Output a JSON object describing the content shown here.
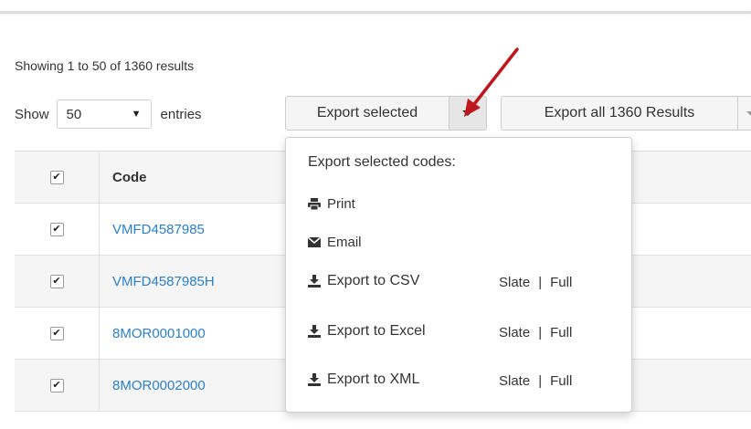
{
  "summary": "Showing 1 to 50 of 1360 results",
  "length_control": {
    "show_label": "Show",
    "selected": "50",
    "entries_label": "entries"
  },
  "toolbar": {
    "export_selected_label": "Export selected",
    "export_all_label": "Export all 1360 Results"
  },
  "table": {
    "header": {
      "code": "Code",
      "description": ""
    },
    "rows": [
      {
        "code": "VMFD4587985",
        "checked": true
      },
      {
        "code": "VMFD4587985H",
        "checked": true
      },
      {
        "code": "8MOR0001000",
        "checked": true
      },
      {
        "code": "8MOR0002000",
        "checked": true
      }
    ]
  },
  "dropdown": {
    "heading": "Export selected codes:",
    "items": [
      {
        "label": "Print",
        "icon": "print-icon"
      },
      {
        "label": "Email",
        "icon": "envelope-icon"
      },
      {
        "label": "Export to CSV",
        "icon": "download-icon",
        "slate": "Slate",
        "sep": "|",
        "full": "Full"
      },
      {
        "label": "Export to Excel",
        "icon": "download-icon",
        "slate": "Slate",
        "sep": "|",
        "full": "Full"
      },
      {
        "label": "Export to XML",
        "icon": "download-icon",
        "slate": "Slate",
        "sep": "|",
        "full": "Full"
      }
    ]
  },
  "colors": {
    "link": "#2a7fc9",
    "arrow": "#c0151b"
  }
}
